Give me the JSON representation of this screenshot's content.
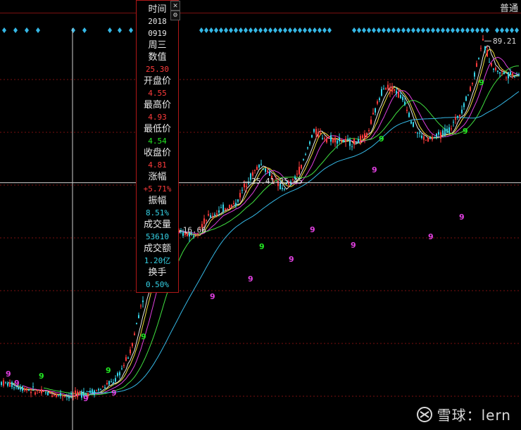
{
  "toolbar": {
    "mode_label": "普通"
  },
  "info_panel": {
    "rows": [
      {
        "label": "时间"
      },
      {
        "value": "2018",
        "tone": "white"
      },
      {
        "value": "0919",
        "tone": "white"
      },
      {
        "label": "周三"
      },
      {
        "label": "数值"
      },
      {
        "value": "25.30",
        "tone": "red"
      },
      {
        "label": "开盘价"
      },
      {
        "value": "4.55",
        "tone": "red"
      },
      {
        "label": "最高价"
      },
      {
        "value": "4.93",
        "tone": "red"
      },
      {
        "label": "最低价"
      },
      {
        "value": "4.54",
        "tone": "green"
      },
      {
        "label": "收盘价"
      },
      {
        "value": "4.81",
        "tone": "red"
      },
      {
        "label": "涨幅"
      },
      {
        "value": "+5.71%",
        "tone": "red"
      },
      {
        "label": "振幅"
      },
      {
        "value": "8.51%",
        "tone": "cyan"
      },
      {
        "label": "成交量"
      },
      {
        "value": "53610",
        "tone": "cyan"
      },
      {
        "label": "成交额"
      },
      {
        "value": "1.20亿",
        "tone": "cyan"
      },
      {
        "label": "换手"
      },
      {
        "value": "0.50%",
        "tone": "cyan"
      }
    ],
    "close_icon": "close-icon",
    "settings_icon": "gear-icon"
  },
  "chart_data": {
    "type": "candlestick",
    "price_labels": [
      {
        "text": "89.21",
        "value": 89.21
      },
      {
        "text": "25.41-25.45",
        "value": 25.43
      },
      {
        "text": "16.65-16.66",
        "value": 16.655
      }
    ],
    "crosshair": {
      "value": 25.3,
      "date": "20180919"
    },
    "colors": {
      "up": "#ff3b3b",
      "down": "#35d2e6",
      "ma_white": "#e8e8e8",
      "ma_yellow": "#f0e040",
      "ma_magenta": "#e040e0",
      "ma_green": "#40e040",
      "ma_cyan": "#35b8e6",
      "signal_marker": "#35b8e6",
      "td_up": "#22e622",
      "td_down": "#e040e0",
      "grid": "#7a1010"
    },
    "td_markers": [
      {
        "text": "9",
        "color": "green"
      },
      {
        "text": "9",
        "color": "magenta"
      }
    ]
  },
  "watermark": {
    "text": "雪球：lern",
    "logo_icon": "snowball-logo-icon"
  }
}
